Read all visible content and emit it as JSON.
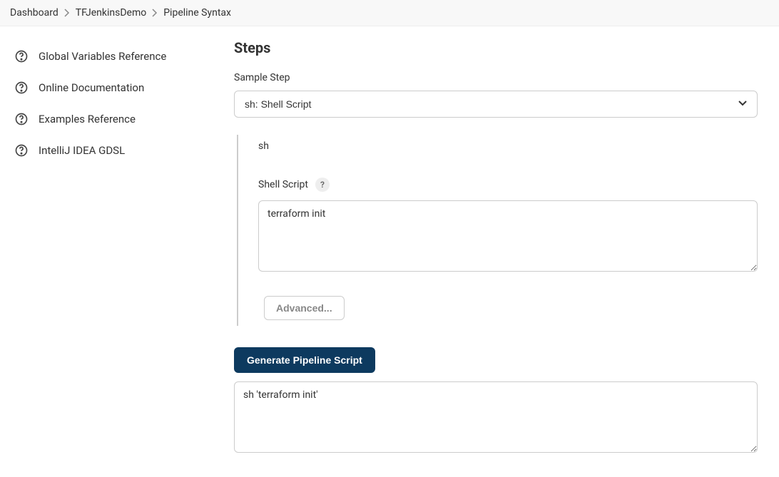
{
  "breadcrumb": {
    "items": [
      "Dashboard",
      "TFJenkinsDemo",
      "Pipeline Syntax"
    ]
  },
  "sidebar": {
    "items": [
      {
        "label": "Global Variables Reference"
      },
      {
        "label": "Online Documentation"
      },
      {
        "label": "Examples Reference"
      },
      {
        "label": "IntelliJ IDEA GDSL"
      }
    ]
  },
  "main": {
    "heading": "Steps",
    "sample_step_label": "Sample Step",
    "sample_step_value": "sh: Shell Script",
    "step_title": "sh",
    "shell_script_label": "Shell Script",
    "help_symbol": "?",
    "shell_script_value": "terraform init",
    "advanced_label": "Advanced...",
    "generate_label": "Generate Pipeline Script",
    "output_value": "sh 'terraform init'"
  }
}
